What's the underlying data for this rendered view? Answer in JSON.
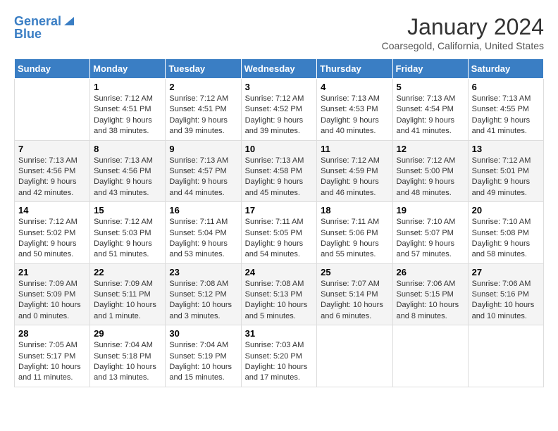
{
  "header": {
    "logo_line1": "General",
    "logo_line2": "Blue",
    "title": "January 2024",
    "subtitle": "Coarsegold, California, United States"
  },
  "days_of_week": [
    "Sunday",
    "Monday",
    "Tuesday",
    "Wednesday",
    "Thursday",
    "Friday",
    "Saturday"
  ],
  "weeks": [
    [
      {
        "day": "",
        "info": ""
      },
      {
        "day": "1",
        "info": "Sunrise: 7:12 AM\nSunset: 4:51 PM\nDaylight: 9 hours\nand 38 minutes."
      },
      {
        "day": "2",
        "info": "Sunrise: 7:12 AM\nSunset: 4:51 PM\nDaylight: 9 hours\nand 39 minutes."
      },
      {
        "day": "3",
        "info": "Sunrise: 7:12 AM\nSunset: 4:52 PM\nDaylight: 9 hours\nand 39 minutes."
      },
      {
        "day": "4",
        "info": "Sunrise: 7:13 AM\nSunset: 4:53 PM\nDaylight: 9 hours\nand 40 minutes."
      },
      {
        "day": "5",
        "info": "Sunrise: 7:13 AM\nSunset: 4:54 PM\nDaylight: 9 hours\nand 41 minutes."
      },
      {
        "day": "6",
        "info": "Sunrise: 7:13 AM\nSunset: 4:55 PM\nDaylight: 9 hours\nand 41 minutes."
      }
    ],
    [
      {
        "day": "7",
        "info": "Sunrise: 7:13 AM\nSunset: 4:56 PM\nDaylight: 9 hours\nand 42 minutes."
      },
      {
        "day": "8",
        "info": "Sunrise: 7:13 AM\nSunset: 4:56 PM\nDaylight: 9 hours\nand 43 minutes."
      },
      {
        "day": "9",
        "info": "Sunrise: 7:13 AM\nSunset: 4:57 PM\nDaylight: 9 hours\nand 44 minutes."
      },
      {
        "day": "10",
        "info": "Sunrise: 7:13 AM\nSunset: 4:58 PM\nDaylight: 9 hours\nand 45 minutes."
      },
      {
        "day": "11",
        "info": "Sunrise: 7:12 AM\nSunset: 4:59 PM\nDaylight: 9 hours\nand 46 minutes."
      },
      {
        "day": "12",
        "info": "Sunrise: 7:12 AM\nSunset: 5:00 PM\nDaylight: 9 hours\nand 48 minutes."
      },
      {
        "day": "13",
        "info": "Sunrise: 7:12 AM\nSunset: 5:01 PM\nDaylight: 9 hours\nand 49 minutes."
      }
    ],
    [
      {
        "day": "14",
        "info": "Sunrise: 7:12 AM\nSunset: 5:02 PM\nDaylight: 9 hours\nand 50 minutes."
      },
      {
        "day": "15",
        "info": "Sunrise: 7:12 AM\nSunset: 5:03 PM\nDaylight: 9 hours\nand 51 minutes."
      },
      {
        "day": "16",
        "info": "Sunrise: 7:11 AM\nSunset: 5:04 PM\nDaylight: 9 hours\nand 53 minutes."
      },
      {
        "day": "17",
        "info": "Sunrise: 7:11 AM\nSunset: 5:05 PM\nDaylight: 9 hours\nand 54 minutes."
      },
      {
        "day": "18",
        "info": "Sunrise: 7:11 AM\nSunset: 5:06 PM\nDaylight: 9 hours\nand 55 minutes."
      },
      {
        "day": "19",
        "info": "Sunrise: 7:10 AM\nSunset: 5:07 PM\nDaylight: 9 hours\nand 57 minutes."
      },
      {
        "day": "20",
        "info": "Sunrise: 7:10 AM\nSunset: 5:08 PM\nDaylight: 9 hours\nand 58 minutes."
      }
    ],
    [
      {
        "day": "21",
        "info": "Sunrise: 7:09 AM\nSunset: 5:09 PM\nDaylight: 10 hours\nand 0 minutes."
      },
      {
        "day": "22",
        "info": "Sunrise: 7:09 AM\nSunset: 5:11 PM\nDaylight: 10 hours\nand 1 minute."
      },
      {
        "day": "23",
        "info": "Sunrise: 7:08 AM\nSunset: 5:12 PM\nDaylight: 10 hours\nand 3 minutes."
      },
      {
        "day": "24",
        "info": "Sunrise: 7:08 AM\nSunset: 5:13 PM\nDaylight: 10 hours\nand 5 minutes."
      },
      {
        "day": "25",
        "info": "Sunrise: 7:07 AM\nSunset: 5:14 PM\nDaylight: 10 hours\nand 6 minutes."
      },
      {
        "day": "26",
        "info": "Sunrise: 7:06 AM\nSunset: 5:15 PM\nDaylight: 10 hours\nand 8 minutes."
      },
      {
        "day": "27",
        "info": "Sunrise: 7:06 AM\nSunset: 5:16 PM\nDaylight: 10 hours\nand 10 minutes."
      }
    ],
    [
      {
        "day": "28",
        "info": "Sunrise: 7:05 AM\nSunset: 5:17 PM\nDaylight: 10 hours\nand 11 minutes."
      },
      {
        "day": "29",
        "info": "Sunrise: 7:04 AM\nSunset: 5:18 PM\nDaylight: 10 hours\nand 13 minutes."
      },
      {
        "day": "30",
        "info": "Sunrise: 7:04 AM\nSunset: 5:19 PM\nDaylight: 10 hours\nand 15 minutes."
      },
      {
        "day": "31",
        "info": "Sunrise: 7:03 AM\nSunset: 5:20 PM\nDaylight: 10 hours\nand 17 minutes."
      },
      {
        "day": "",
        "info": ""
      },
      {
        "day": "",
        "info": ""
      },
      {
        "day": "",
        "info": ""
      }
    ]
  ]
}
